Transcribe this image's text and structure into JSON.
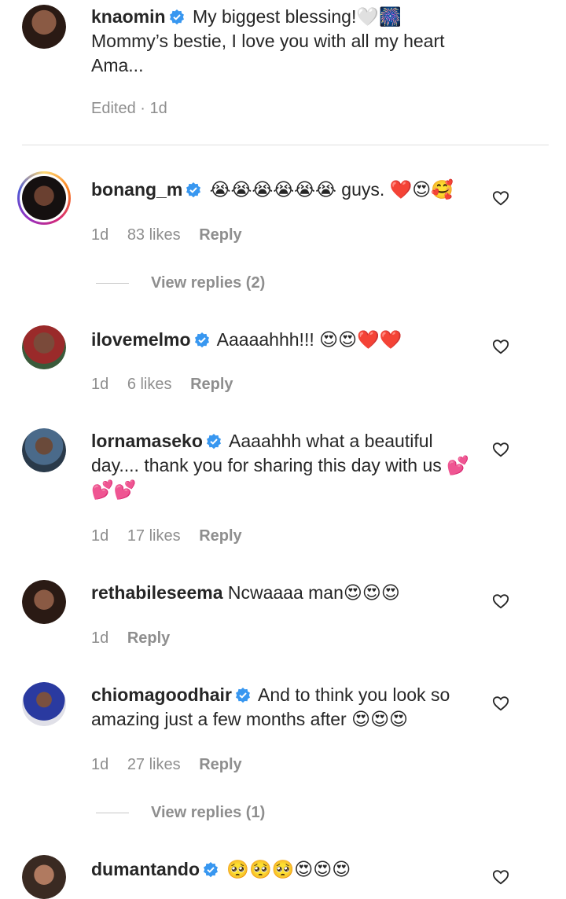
{
  "comments": [
    {
      "username": "knaomin",
      "text": "My biggest blessing!🤍🎆 Mommy’s bestie, I love you with all my heart Ama...",
      "meta": {
        "time": "Edited · 1d",
        "likes": "",
        "reply": ""
      },
      "avatar_color": "#3a2a22"
    },
    {
      "username": "bonang_m",
      "text": "😭😭😭😭😭😭 guys. ❤️😍🥰",
      "meta": {
        "time": "1d",
        "likes": "83 likes",
        "reply": "Reply"
      },
      "view_replies": "View replies (2)",
      "avatar_color": "#1f1a18"
    },
    {
      "username": "ilovemelmo",
      "text": "Aaaaahhh!!! 😍😍❤️❤️",
      "meta": {
        "time": "1d",
        "likes": "6 likes",
        "reply": "Reply"
      },
      "avatar_color": "#8a2a2a"
    },
    {
      "username": "lornamaseko",
      "text": "Aaaahhh what a beautiful day.... thank you for sharing this day with us 💕💕💕",
      "meta": {
        "time": "1d",
        "likes": "17 likes",
        "reply": "Reply"
      },
      "avatar_color": "#4a6a8a"
    },
    {
      "username": "rethabileseema",
      "text": "Ncwaaaa man😍😍😍",
      "meta": {
        "time": "1d",
        "likes": "",
        "reply": "Reply"
      },
      "avatar_color": "#5a3a2a"
    },
    {
      "username": "chiomagoodhair",
      "text": "And to think you look so amazing just a few months after 😍😍😍",
      "meta": {
        "time": "1d",
        "likes": "27 likes",
        "reply": "Reply"
      },
      "view_replies": "View replies (1)",
      "avatar_color": "#2a3aa0"
    },
    {
      "username": "dumantando",
      "text": "🥺🥺🥺😍😍😍",
      "meta": {
        "time": "",
        "likes": "",
        "reply": ""
      },
      "avatar_color": "#6a4a3a"
    }
  ],
  "colors": {
    "verified": "#3897f0",
    "meta": "#8e8e8e",
    "text": "#262626"
  },
  "icons": {
    "like": "heart-outline-icon",
    "verified": "verified-badge-icon"
  }
}
